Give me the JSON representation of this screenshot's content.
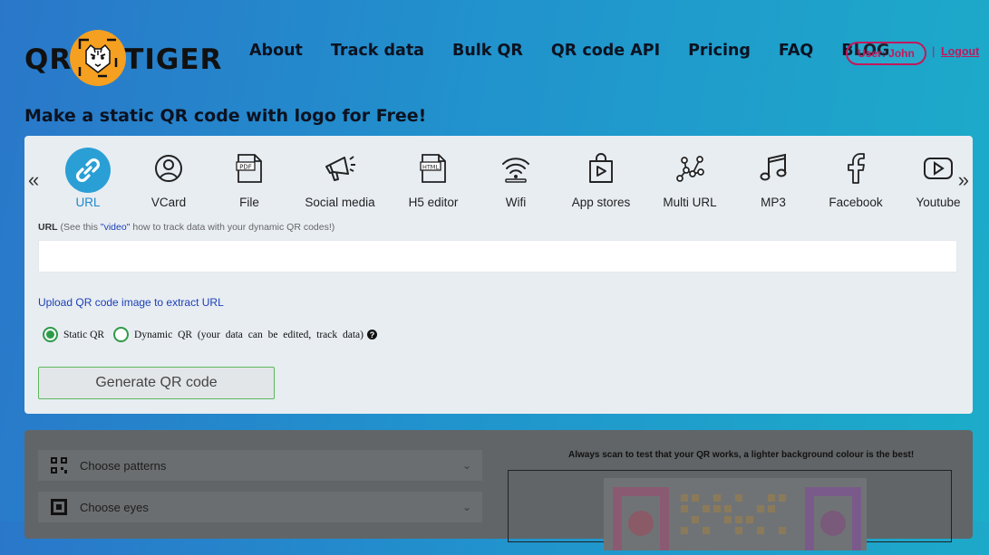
{
  "brand": {
    "logo_left": "QR",
    "logo_right": "TIGER"
  },
  "nav": [
    "About",
    "Track data",
    "Bulk QR",
    "QR code API",
    "Pricing",
    "FAQ",
    "BLOG"
  ],
  "user": {
    "pill": "User: John",
    "separator": "|",
    "logout": "Logout"
  },
  "page_title": "Make a static QR code with logo for Free!",
  "arrows": {
    "left": "«",
    "right": "»"
  },
  "types": [
    {
      "label": "URL",
      "icon": "link-icon",
      "active": true
    },
    {
      "label": "VCard",
      "icon": "user-circle-icon"
    },
    {
      "label": "File",
      "icon": "pdf-file-icon"
    },
    {
      "label": "Social media",
      "icon": "megaphone-icon"
    },
    {
      "label": "H5 editor",
      "icon": "html-file-icon"
    },
    {
      "label": "Wifi",
      "icon": "wifi-icon"
    },
    {
      "label": "App stores",
      "icon": "app-store-bag-icon"
    },
    {
      "label": "Multi URL",
      "icon": "network-nodes-icon"
    },
    {
      "label": "MP3",
      "icon": "music-note-icon"
    },
    {
      "label": "Facebook",
      "icon": "facebook-icon"
    },
    {
      "label": "Youtube",
      "icon": "youtube-icon"
    }
  ],
  "form": {
    "url_label": "URL",
    "url_hint_pre": "(See this ",
    "url_hint_link": "\"video\"",
    "url_hint_post": " how to track data with your dynamic QR codes!)",
    "url_value": "",
    "upload_link": "Upload QR code image to extract URL",
    "radio_static": "Static QR",
    "radio_dynamic": "Dynamic QR (your data can be edited, track data)",
    "help_icon": "?",
    "generate_button": "Generate QR code"
  },
  "customize": {
    "options": [
      {
        "label": "Choose patterns",
        "icon": "qr-pattern-icon"
      },
      {
        "label": "Choose eyes",
        "icon": "qr-eye-icon"
      }
    ],
    "tip": "Always scan to test that your QR works, a lighter background colour is the best!"
  },
  "colors": {
    "accent": "#2a9fd6",
    "user": "#c2185b",
    "radio": "#2e9b49",
    "button_border": "#5cb85c"
  }
}
